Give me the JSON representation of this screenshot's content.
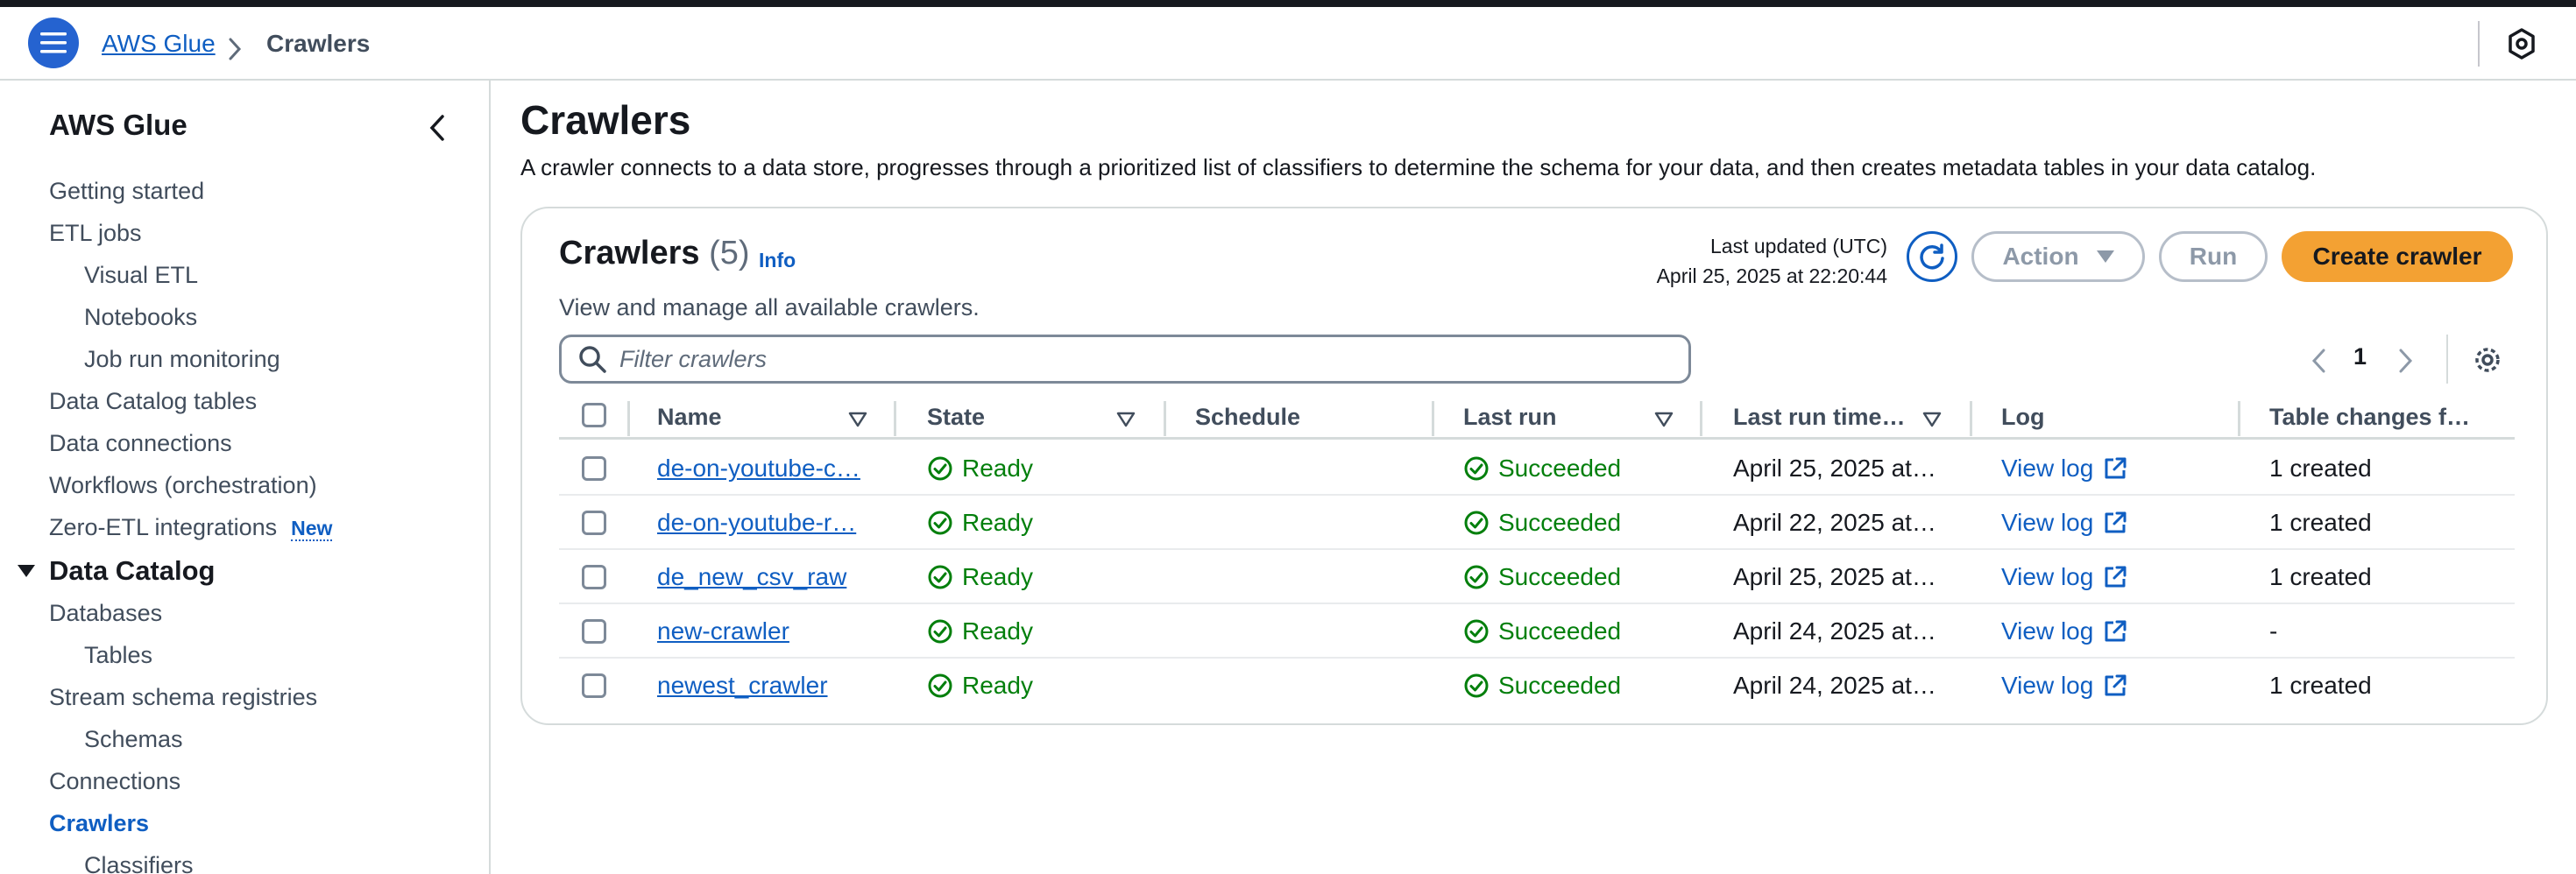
{
  "breadcrumb": {
    "root": "AWS Glue",
    "current": "Crawlers"
  },
  "sidebar": {
    "title": "AWS Glue",
    "items": [
      {
        "label": "Getting started"
      },
      {
        "label": "ETL jobs"
      },
      {
        "label": "Visual ETL"
      },
      {
        "label": "Notebooks"
      },
      {
        "label": "Job run monitoring"
      },
      {
        "label": "Data Catalog tables"
      },
      {
        "label": "Data connections"
      },
      {
        "label": "Workflows (orchestration)"
      },
      {
        "label": "Zero-ETL integrations",
        "badge": "New"
      },
      {
        "label": "Data Catalog"
      },
      {
        "label": "Databases"
      },
      {
        "label": "Tables"
      },
      {
        "label": "Stream schema registries"
      },
      {
        "label": "Schemas"
      },
      {
        "label": "Connections"
      },
      {
        "label": "Crawlers"
      },
      {
        "label": "Classifiers"
      }
    ]
  },
  "page": {
    "title": "Crawlers",
    "description": "A crawler connects to a data store, progresses through a prioritized list of classifiers to determine the schema for your data, and then creates metadata tables in your data catalog."
  },
  "card": {
    "title": "Crawlers",
    "count": "(5)",
    "info": "Info",
    "description": "View and manage all available crawlers.",
    "last_updated_label": "Last updated (UTC)",
    "last_updated_value": "April 25, 2025 at 22:20:44",
    "action_label": "Action",
    "run_label": "Run",
    "create_label": "Create crawler",
    "filter_placeholder": "Filter crawlers",
    "page_number": "1"
  },
  "table": {
    "columns": [
      "Name",
      "State",
      "Schedule",
      "Last run",
      "Last run time…",
      "Log",
      "Table changes f…"
    ],
    "rows": [
      {
        "name": "de-on-youtube-c…",
        "state": "Ready",
        "schedule": "",
        "last_run": "Succeeded",
        "last_run_time": "April 25, 2025 at…",
        "log": "View log",
        "table_changes": "1 created"
      },
      {
        "name": "de-on-youtube-r…",
        "state": "Ready",
        "schedule": "",
        "last_run": "Succeeded",
        "last_run_time": "April 22, 2025 at…",
        "log": "View log",
        "table_changes": "1 created"
      },
      {
        "name": "de_new_csv_raw",
        "state": "Ready",
        "schedule": "",
        "last_run": "Succeeded",
        "last_run_time": "April 25, 2025 at…",
        "log": "View log",
        "table_changes": "1 created"
      },
      {
        "name": "new-crawler",
        "state": "Ready",
        "schedule": "",
        "last_run": "Succeeded",
        "last_run_time": "April 24, 2025 at…",
        "log": "View log",
        "table_changes": "-"
      },
      {
        "name": "newest_crawler",
        "state": "Ready",
        "schedule": "",
        "last_run": "Succeeded",
        "last_run_time": "April 24, 2025 at…",
        "log": "View log",
        "table_changes": "1 created"
      }
    ]
  },
  "colors": {
    "accent": "#0f5ec2",
    "success": "#037f0c",
    "primary_button": "#f3a133",
    "menu_button": "#2563d0"
  },
  "icons": [
    "menu-icon",
    "chevron-right-icon",
    "settings-icon",
    "chevron-left-icon",
    "refresh-icon",
    "search-icon",
    "sort-icon",
    "status-success-icon",
    "external-link-icon"
  ]
}
